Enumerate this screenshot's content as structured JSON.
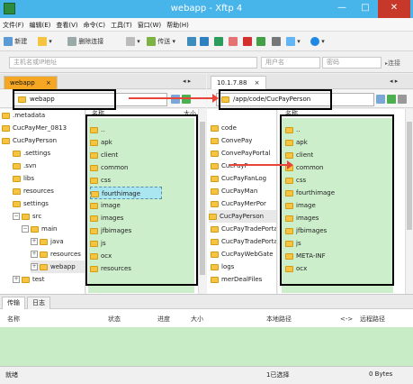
{
  "window": {
    "title": "webapp - Xftp 4"
  },
  "menu": [
    "文件(F)",
    "编辑(E)",
    "查看(V)",
    "命令(C)",
    "工具(T)",
    "窗口(W)",
    "帮助(H)"
  ],
  "toolbar": {
    "new_label": "新建",
    "disconnect_label": "删除连接",
    "transfer_label": "传送"
  },
  "address": {
    "host_placeholder": "主机名或IP地址",
    "user_placeholder": "用户名",
    "password_placeholder": "密码",
    "connect_label": "连接"
  },
  "left": {
    "tab": "webapp",
    "path": "webapp",
    "tree": [
      ".metadata",
      "CucPayMer_0813",
      "CucPayPerson",
      ".settings",
      ".svn",
      "libs",
      "resources",
      "settings",
      "src",
      "main",
      "java",
      "resources",
      "webapp",
      "test"
    ],
    "list_header": "名称",
    "list_header_size": "大小",
    "files": [
      "..",
      "apk",
      "client",
      "common",
      "css",
      "fourthimage",
      "image",
      "images",
      "jfbimages",
      "js",
      "ocx",
      "resources"
    ]
  },
  "right": {
    "tab": "10.1.7.88",
    "path": "/app/code/CucPayPerson",
    "tree": [
      "code",
      "ConvePay",
      "ConvePayPortal",
      "CucPayF",
      "CucPayFanLog",
      "CucPayMan",
      "CucPayMerPor",
      "CucPayPerson",
      "CucPayTradePortal",
      "CucPayTradePortal",
      "CucPayWebGate",
      "logs",
      "merDealFiles"
    ],
    "list_header": "名称",
    "files": [
      "..",
      "apk",
      "client",
      "common",
      "css",
      "fourthimage",
      "image",
      "images",
      "jfbimages",
      "js",
      "META-INF",
      "ocx"
    ]
  },
  "transfer": {
    "tabs": [
      "传输",
      "日志"
    ],
    "columns": [
      "名称",
      "状态",
      "进度",
      "大小",
      "本地路径",
      "<->",
      "远程路径"
    ]
  },
  "status": {
    "left": "就绪",
    "middle": "1已选择",
    "right": "0 Bytes"
  }
}
